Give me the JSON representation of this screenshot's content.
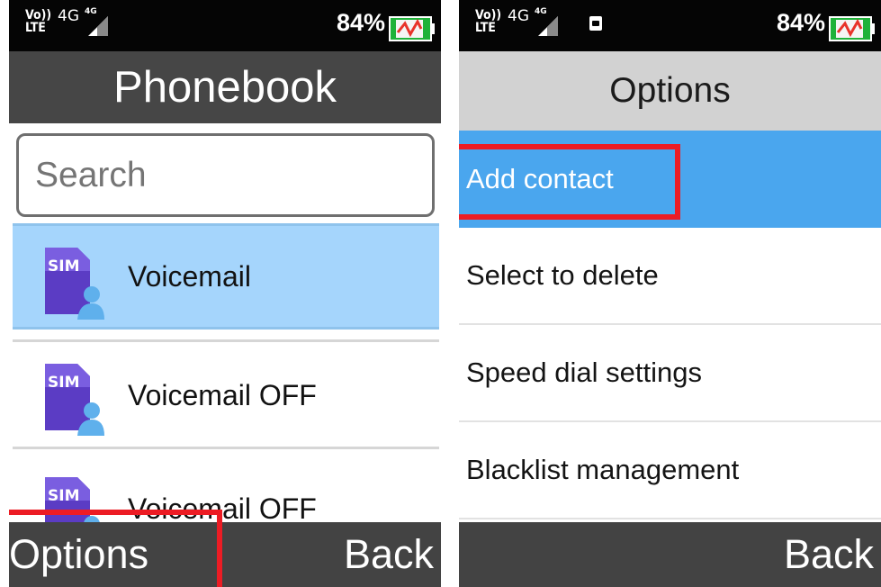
{
  "left_screen": {
    "status": {
      "volte_top": "Vo))",
      "volte_bottom": "LTE",
      "network": "4G",
      "signal_label": "4G",
      "battery_percent": "84%"
    },
    "title": "Phonebook",
    "search": {
      "placeholder": "Search",
      "value": ""
    },
    "contacts": [
      {
        "name": "Voicemail",
        "icon": "sim-contact-icon",
        "selected": true
      },
      {
        "name": "Voicemail OFF",
        "icon": "sim-contact-icon",
        "selected": false
      },
      {
        "name": "Voicemail OFF",
        "icon": "sim-contact-icon",
        "selected": false
      }
    ],
    "softkeys": {
      "left": "Options",
      "right": "Back"
    }
  },
  "right_screen": {
    "status": {
      "volte_top": "Vo))",
      "volte_bottom": "LTE",
      "network": "4G",
      "signal_label": "4G",
      "battery_percent": "84%"
    },
    "title": "Options",
    "menu": [
      {
        "label": "Add contact",
        "selected": true
      },
      {
        "label": "Select to delete",
        "selected": false
      },
      {
        "label": "Speed dial settings",
        "selected": false
      },
      {
        "label": "Blacklist management",
        "selected": false
      }
    ],
    "softkeys": {
      "right": "Back"
    }
  },
  "colors": {
    "status_bar": "#050505",
    "phonebook_title_bg": "#464646",
    "options_title_bg": "#d2d2d2",
    "selected_contact_bg": "#a5d5fc",
    "selected_menu_bg": "#4aa6ee",
    "softkey_bar": "#434343",
    "highlight_box": "#ec1c24",
    "battery_fill": "#1fb23a"
  }
}
